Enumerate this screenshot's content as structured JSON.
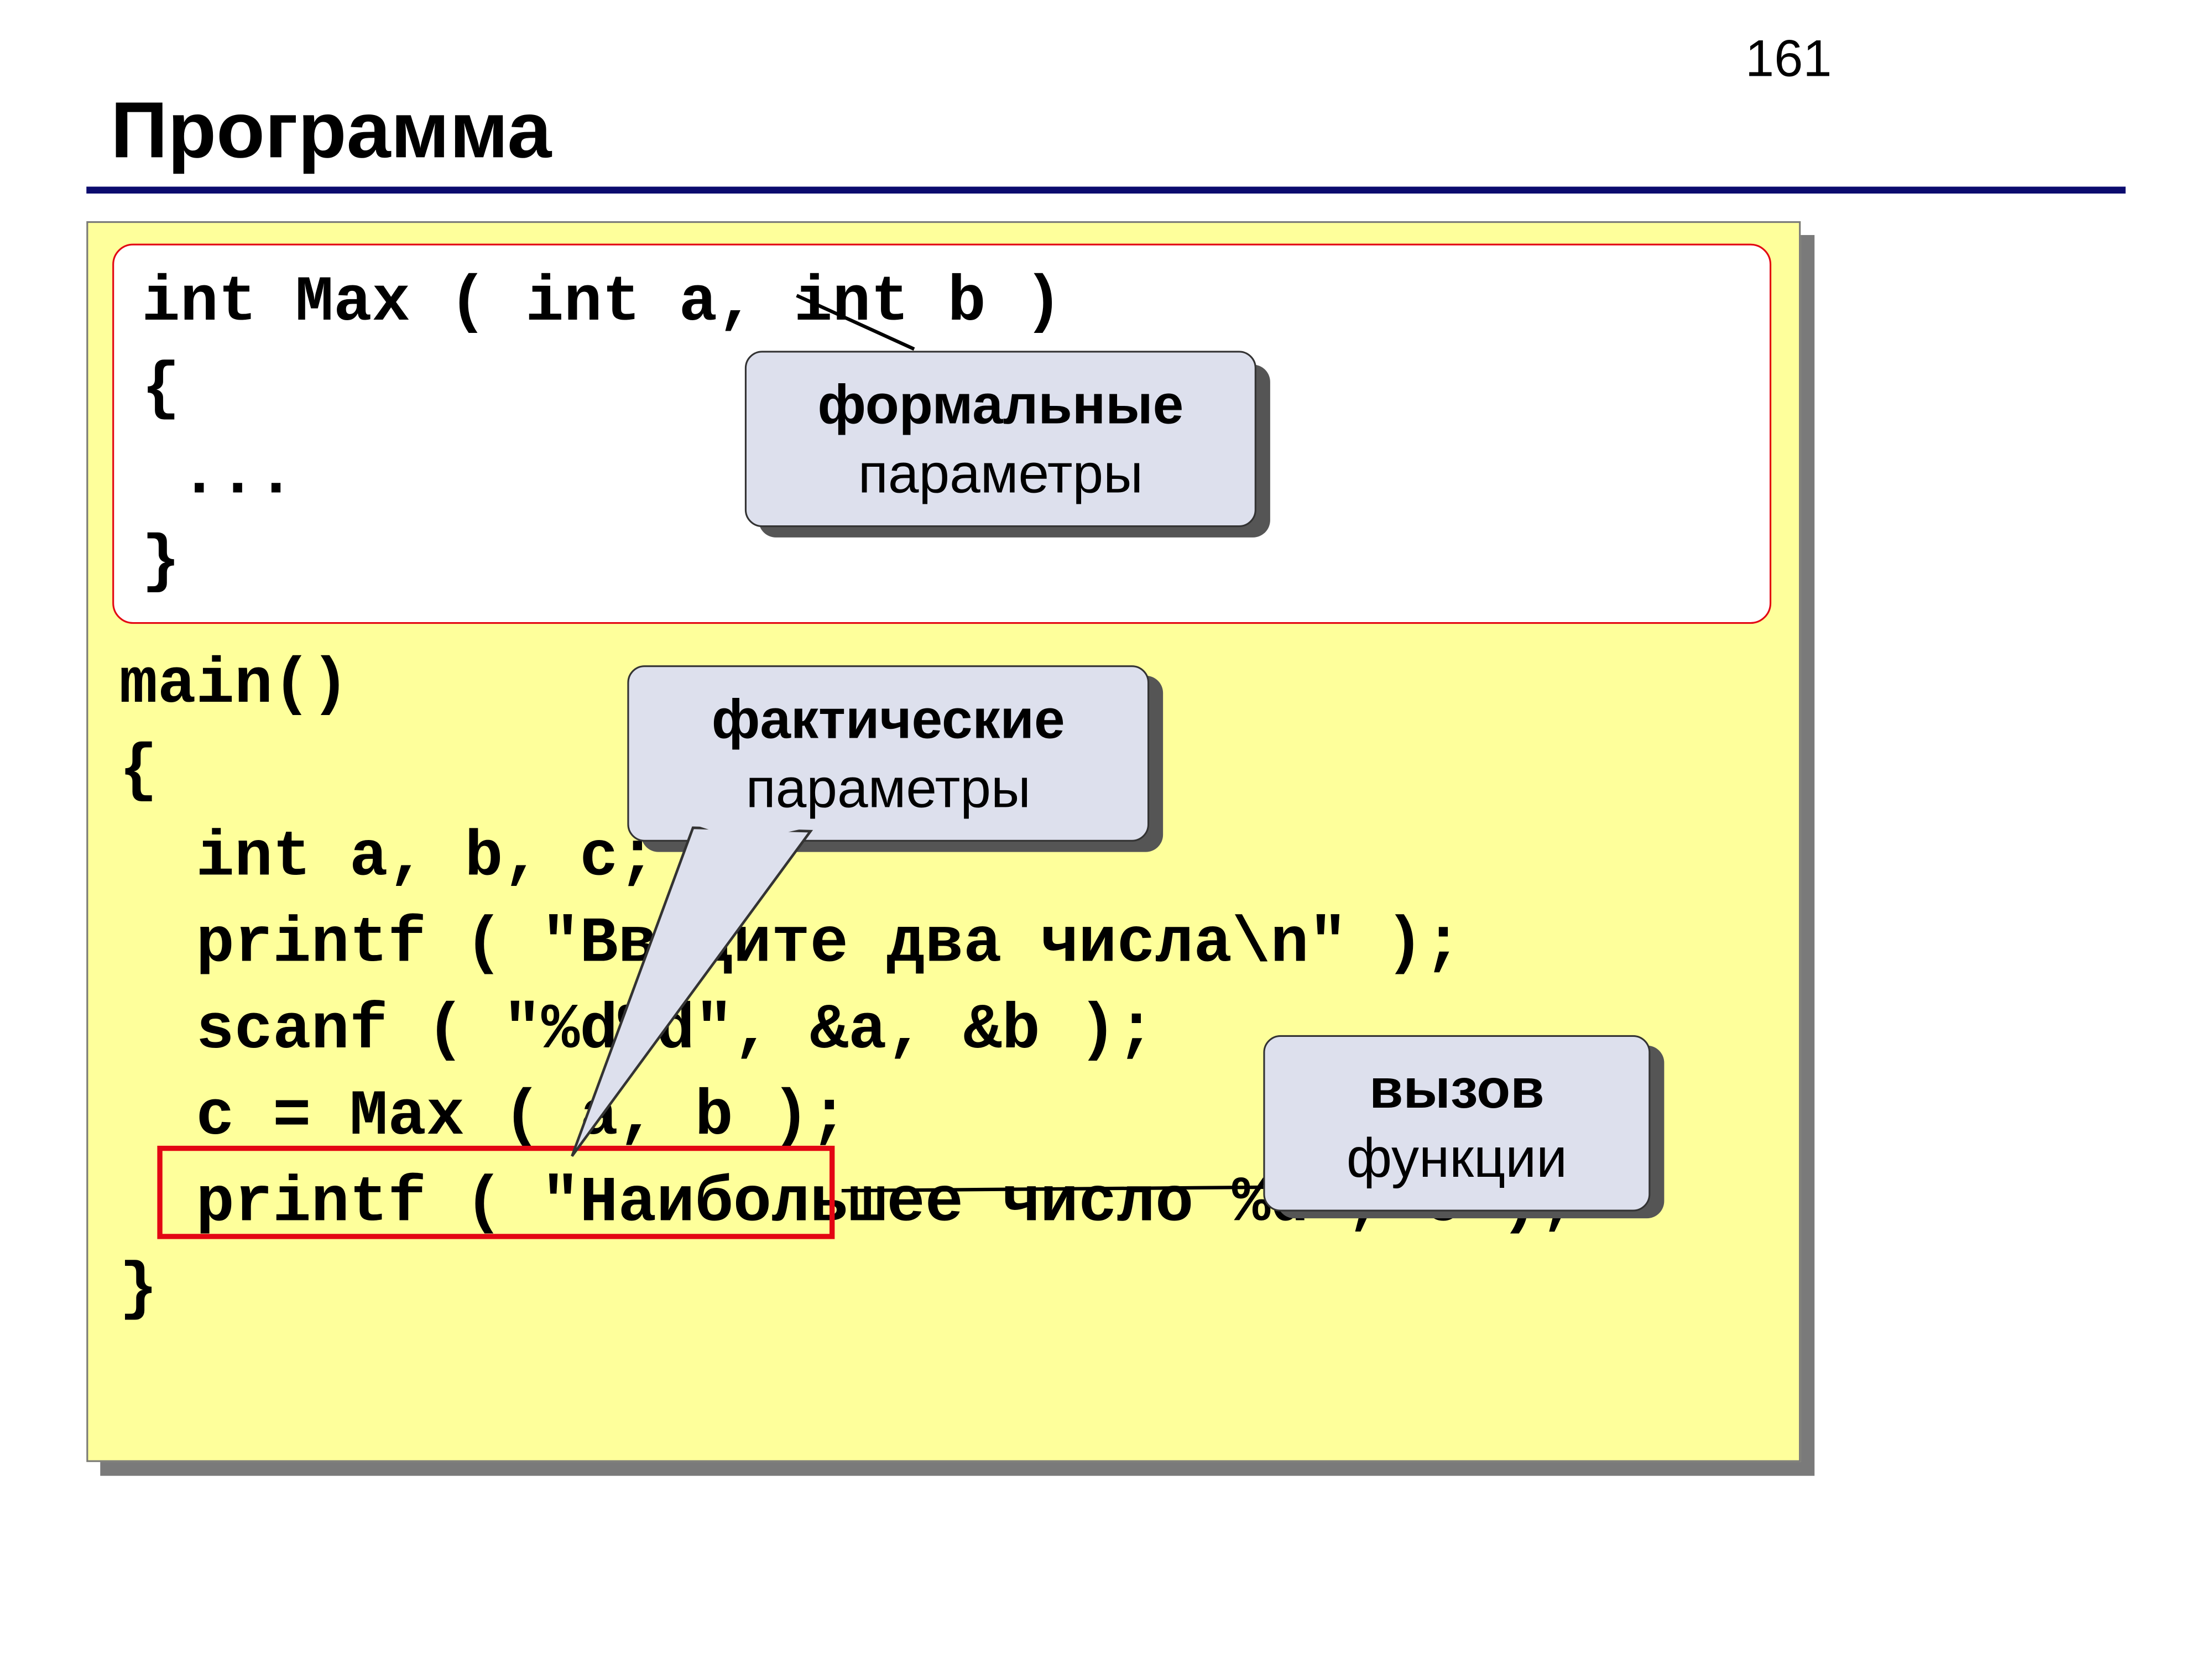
{
  "page_number": "161",
  "title": "Программа",
  "function_box": {
    "l1": "int Max ( int a, int b )",
    "l2": "{",
    "l3": " ...",
    "l4": "}"
  },
  "main_code": {
    "l1": "main()",
    "l2": "{",
    "l3": "  int a, b, c;",
    "l4": "  printf ( \"Введите два числа\\n\" );",
    "l5": "  scanf ( \"%d%d\", &a, &b );",
    "l6": "  c = Max ( a, b );",
    "l7": "  printf ( \"Наибольшее число %d\", c );",
    "l8": "}"
  },
  "callouts": {
    "formal_strong": "формальные",
    "formal_normal": "параметры",
    "actual_strong": "фактические",
    "actual_normal": "параметры",
    "call_strong": "вызов",
    "call_normal": "функции"
  }
}
